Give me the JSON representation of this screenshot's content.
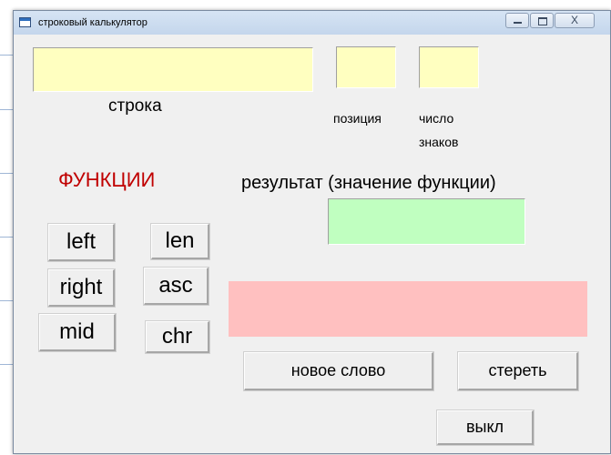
{
  "window": {
    "title": "строковый калькулятор",
    "close_glyph": "X"
  },
  "labels": {
    "string": "строка",
    "position": "позиция",
    "char_count_line1": "число",
    "char_count_line2": "знаков",
    "functions": "ФУНКЦИИ",
    "result": "результат (значение функции)"
  },
  "inputs": {
    "string_value": "",
    "position_value": "",
    "char_count_value": "",
    "result_value": "",
    "output_value": ""
  },
  "buttons": {
    "left": "left",
    "len": "len",
    "right": "right",
    "asc": "asc",
    "mid": "mid",
    "chr": "chr",
    "new_word": "новое слово",
    "clear": "стереть",
    "exit": "выкл"
  },
  "colors": {
    "input_yellow": "#ffffc0",
    "result_green": "#c0ffc0",
    "output_red": "#ffc0c0",
    "functions_label": "#c00000"
  },
  "icons": {
    "app": "app-window-icon",
    "minimize": "minimize-icon",
    "maximize": "maximize-icon",
    "close": "close-icon"
  }
}
